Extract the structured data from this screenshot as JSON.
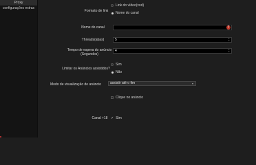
{
  "sidebar": {
    "items": [
      {
        "label": "Proxy"
      },
      {
        "label": "configurações extras"
      }
    ]
  },
  "form": {
    "link_format": {
      "label": "Formato de link",
      "options": [
        "Link do vídeo(vod)",
        "Nome do canal"
      ],
      "selected": 1
    },
    "channel_name": {
      "label": "Nome do canal",
      "value": "",
      "warning": "!"
    },
    "threads": {
      "label": "Threads(abas)",
      "value": "5"
    },
    "ad_wait": {
      "label": "Tempo de espera do anúncio (Segundos)",
      "value": "4"
    },
    "limit_ads": {
      "label": "Limitar os Anúncios assistidos?",
      "options": [
        "Sim",
        "Não"
      ],
      "selected": 1
    },
    "ad_view_mode": {
      "label": "Modo de visualização de anúncio",
      "value": "assistir até o fim"
    },
    "click_ad": {
      "label": "Clique no anúncio",
      "checked": false
    },
    "adult_channel": {
      "label": "Canal +18",
      "option": "Sim",
      "checked": true
    }
  },
  "icons": {
    "spin_up": "▴",
    "spin_down": "▾",
    "chevron": "▾",
    "tick": "✓"
  }
}
